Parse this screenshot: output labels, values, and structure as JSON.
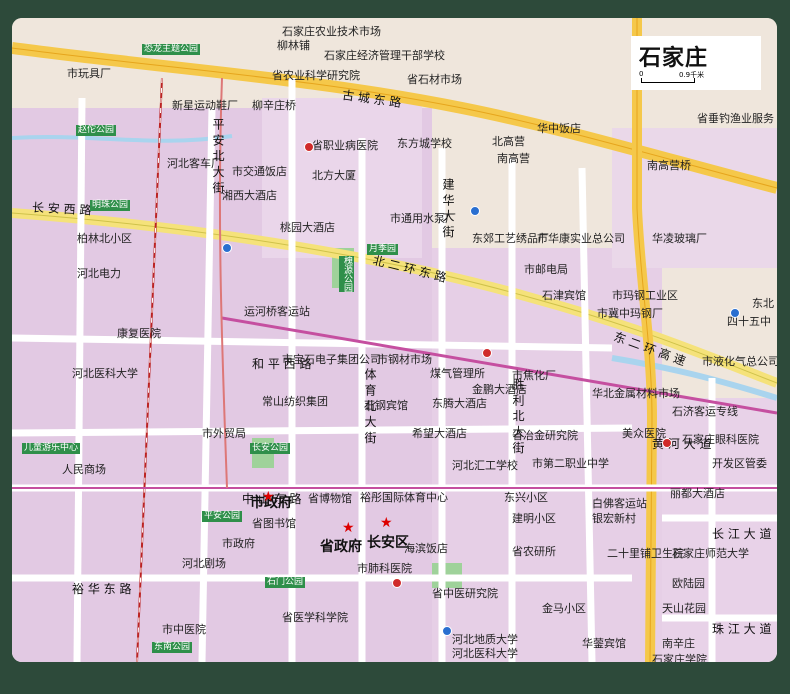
{
  "map_title": "石家庄",
  "scale": {
    "left": "0",
    "right": "0.9千米"
  },
  "roads": [
    {
      "id": "r1",
      "text": "古 城 东 路"
    },
    {
      "id": "r2",
      "text": "长 安 西 路"
    },
    {
      "id": "r3",
      "text": "和 平 西 路"
    },
    {
      "id": "r4",
      "text": "北 二 环 东 路"
    },
    {
      "id": "r5",
      "text": "建 华 大 街"
    },
    {
      "id": "r6",
      "text": "中 山 东 路"
    },
    {
      "id": "r7",
      "text": "体 育 北 大 街"
    },
    {
      "id": "r8",
      "text": "胜 利 北 大 街"
    },
    {
      "id": "r9",
      "text": "东 二 环 高 速"
    },
    {
      "id": "r10",
      "text": "裕 华 东 路"
    },
    {
      "id": "r11",
      "text": "平 安 北 大 街"
    },
    {
      "id": "r12",
      "text": "长 江 大 道"
    },
    {
      "id": "r13",
      "text": "黄 河 大 道"
    },
    {
      "id": "r14",
      "text": "珠 江 大 道"
    }
  ],
  "big_labels": [
    {
      "id": "b1",
      "text": "市政府"
    },
    {
      "id": "b2",
      "text": "省政府"
    },
    {
      "id": "b3",
      "text": "长安区"
    }
  ],
  "parks": [
    {
      "id": "p1",
      "text": "恐龙主题公园"
    },
    {
      "id": "p2",
      "text": "赵佗公园"
    },
    {
      "id": "p3",
      "text": "明珠公园"
    },
    {
      "id": "p4",
      "text": "槐源公园"
    },
    {
      "id": "p5",
      "text": "月季园"
    },
    {
      "id": "p6",
      "text": "长安公园"
    },
    {
      "id": "p7",
      "text": "平安公园"
    },
    {
      "id": "p8",
      "text": "石门公园"
    },
    {
      "id": "p9",
      "text": "东南公园"
    },
    {
      "id": "p10",
      "text": "儿童游乐中心"
    }
  ],
  "places": [
    {
      "id": "l1",
      "text": "石家庄农业技术市场"
    },
    {
      "id": "l2",
      "text": "石家庄经济管理干部学校"
    },
    {
      "id": "l3",
      "text": "省农业科学研究院"
    },
    {
      "id": "l4",
      "text": "省石材市场"
    },
    {
      "id": "l5",
      "text": "柳林铺"
    },
    {
      "id": "l6",
      "text": "市玩具厂"
    },
    {
      "id": "l7",
      "text": "新星运动鞋厂"
    },
    {
      "id": "l8",
      "text": "柳辛庄桥"
    },
    {
      "id": "l9",
      "text": "华中饭店"
    },
    {
      "id": "l10",
      "text": "省垂钓渔业服务"
    },
    {
      "id": "l11",
      "text": "南高营桥"
    },
    {
      "id": "l12",
      "text": "东方城学校"
    },
    {
      "id": "l13",
      "text": "北高营"
    },
    {
      "id": "l14",
      "text": "南高营"
    },
    {
      "id": "l15",
      "text": "省职业病医院"
    },
    {
      "id": "l16",
      "text": "市交通饭店"
    },
    {
      "id": "l17",
      "text": "北方大厦"
    },
    {
      "id": "l18",
      "text": "河北客车厂"
    },
    {
      "id": "l19",
      "text": "湘西大酒店"
    },
    {
      "id": "l20",
      "text": "桃园大酒店"
    },
    {
      "id": "l21",
      "text": "市通用水泵厂"
    },
    {
      "id": "l22",
      "text": "柏林北小区"
    },
    {
      "id": "l23",
      "text": "河北电力"
    },
    {
      "id": "l24",
      "text": "市邮电局"
    },
    {
      "id": "l25",
      "text": "东郊工艺绣品厂"
    },
    {
      "id": "l26",
      "text": "市华康实业总公司"
    },
    {
      "id": "l27",
      "text": "华凌玻璃厂"
    },
    {
      "id": "l28",
      "text": "市玛钢工业区"
    },
    {
      "id": "l29",
      "text": "石津宾馆"
    },
    {
      "id": "l30",
      "text": "市冀中玛钢厂"
    },
    {
      "id": "l31",
      "text": "四十五中"
    },
    {
      "id": "l32",
      "text": "东北"
    },
    {
      "id": "l33",
      "text": "市液化气总公司"
    },
    {
      "id": "l34",
      "text": "运河桥客运站"
    },
    {
      "id": "l35",
      "text": "康复医院"
    },
    {
      "id": "l36",
      "text": "市宝石电子集团公司"
    },
    {
      "id": "l37",
      "text": "市钢材市场"
    },
    {
      "id": "l38",
      "text": "煤气管理所"
    },
    {
      "id": "l39",
      "text": "市焦化厂"
    },
    {
      "id": "l40",
      "text": "华北金属材料市场"
    },
    {
      "id": "l41",
      "text": "常山纺织集团"
    },
    {
      "id": "l42",
      "text": "石钢宾馆"
    },
    {
      "id": "l43",
      "text": "东腾大酒店"
    },
    {
      "id": "l44",
      "text": "金鹏大酒店"
    },
    {
      "id": "l45",
      "text": "省冶金研究院"
    },
    {
      "id": "l46",
      "text": "美众医院"
    },
    {
      "id": "l47",
      "text": "石家庄眼科医院"
    },
    {
      "id": "l48",
      "text": "石济客运专线"
    },
    {
      "id": "l49",
      "text": "河北医科大学"
    },
    {
      "id": "l50",
      "text": "市外贸局"
    },
    {
      "id": "l51",
      "text": "希望大酒店"
    },
    {
      "id": "l52",
      "text": "河北汇工学校"
    },
    {
      "id": "l53",
      "text": "市第二职业中学"
    },
    {
      "id": "l54",
      "text": "人民商场"
    },
    {
      "id": "l55",
      "text": "省博物馆"
    },
    {
      "id": "l56",
      "text": "裕彤国际体育中心"
    },
    {
      "id": "l57",
      "text": "东兴小区"
    },
    {
      "id": "l58",
      "text": "建明小区"
    },
    {
      "id": "l59",
      "text": "银宏新村"
    },
    {
      "id": "l60",
      "text": "白佛客运站"
    },
    {
      "id": "l61",
      "text": "丽都大酒店"
    },
    {
      "id": "l62",
      "text": "开发区管委"
    },
    {
      "id": "l63",
      "text": "省图书馆"
    },
    {
      "id": "l64",
      "text": "河北剧场"
    },
    {
      "id": "l65",
      "text": "海滨饭店"
    },
    {
      "id": "l66",
      "text": "省农研所"
    },
    {
      "id": "l67",
      "text": "二十里铺卫生院"
    },
    {
      "id": "l68",
      "text": "石家庄师范大学"
    },
    {
      "id": "l69",
      "text": "市肺科医院"
    },
    {
      "id": "l70",
      "text": "省中医研究院"
    },
    {
      "id": "l71",
      "text": "金马小区"
    },
    {
      "id": "l72",
      "text": "天山花园"
    },
    {
      "id": "l73",
      "text": "欧陆园"
    },
    {
      "id": "l74",
      "text": "省医学科学院"
    },
    {
      "id": "l75",
      "text": "河北地质大学"
    },
    {
      "id": "l76",
      "text": "河北医科大学"
    },
    {
      "id": "l77",
      "text": "华蓥宾馆"
    },
    {
      "id": "l78",
      "text": "南辛庄"
    },
    {
      "id": "l79",
      "text": "石家庄学院"
    },
    {
      "id": "l80",
      "text": "市中医院"
    },
    {
      "id": "l81",
      "text": "市政府"
    }
  ]
}
